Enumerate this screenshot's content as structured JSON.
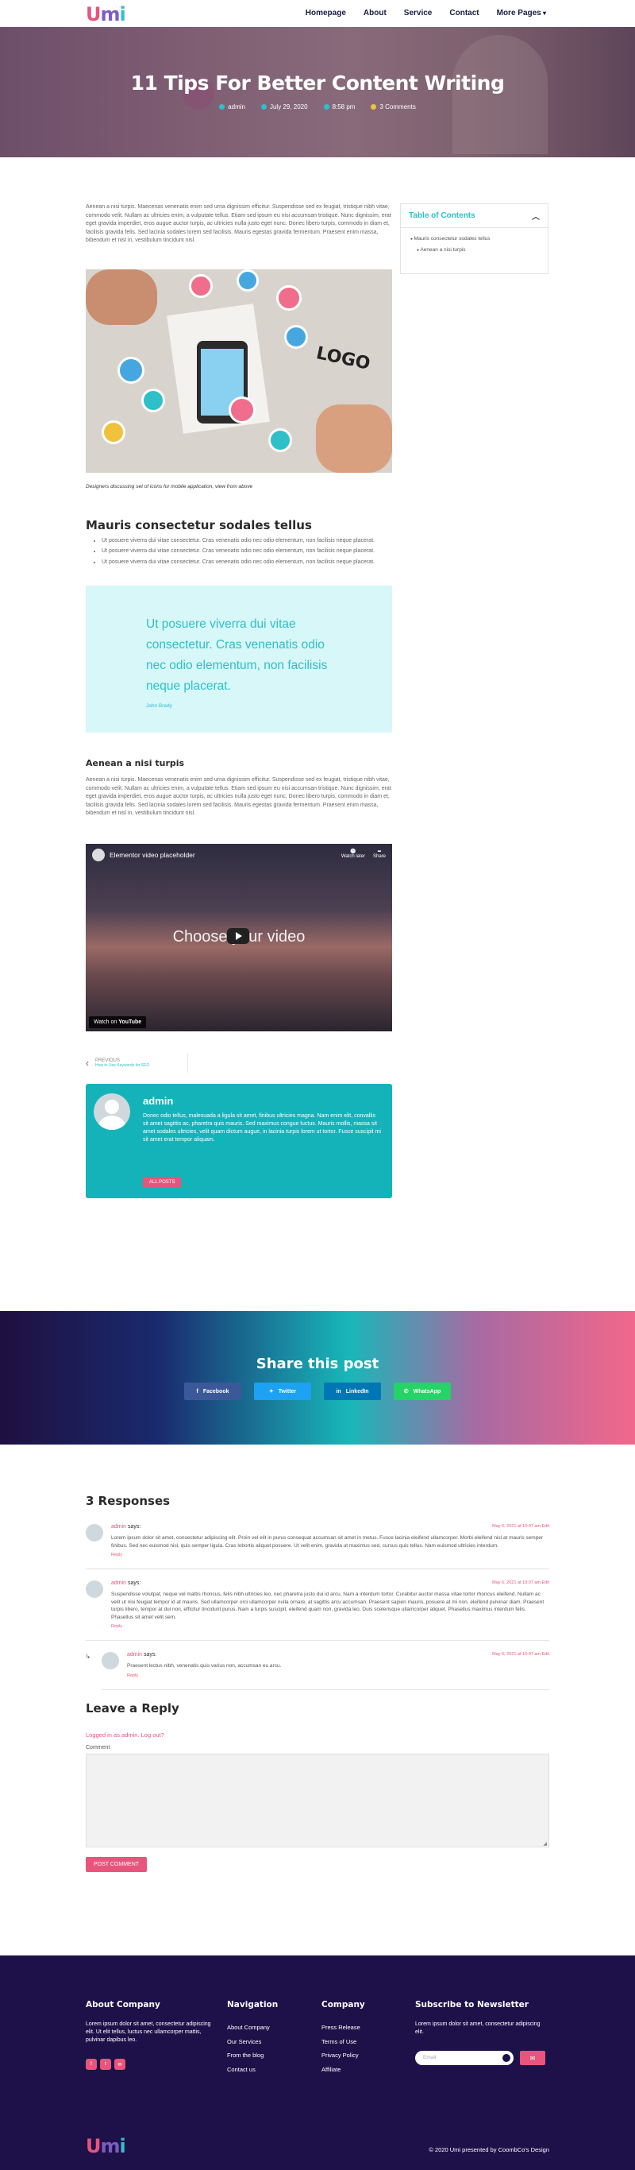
{
  "header": {
    "logo": {
      "u": "U",
      "m": "m",
      "i": "i"
    },
    "nav": [
      "Homepage",
      "About",
      "Service",
      "Contact",
      "More Pages"
    ]
  },
  "hero": {
    "title": "11 Tips For Better Content Writing",
    "meta": {
      "author": "admin",
      "date": "July 29, 2020",
      "time": "8:58 pm",
      "comments": "3 Comments"
    }
  },
  "article": {
    "intro": "Aenean a nisi turpis. Maecenas venenatis enim sed urna dignissim efficitur. Suspendisse sed ex feugiat, tristique nibh vitae, commodo velit. Nullam ac ultricies enim, a vulputate tellus. Etiam sed ipsum eu nisi accumsan tristique. Nunc dignissim, erat eget gravida imperdiet, eros augue auctor turpis, ac ultricies nulla justo eget nunc. Donec libero turpis, commodo in diam et, facilisis gravida felis. Sed lacinia sodales lorem sed facilisis. Mauris egestas gravida fermentum. Praesent enim massa, bibendum et nisl in, vestibulum tincidunt nisl.",
    "image_logo_text": "LOGO",
    "caption": "Designers discussing set of icons for mobile application, view from above",
    "h2": "Mauris consectetur sodales tellus",
    "bullets": [
      "Ut posuere viverra dui vitae consectetur. Cras venenatis odio nec odio elementum, non facilisis neque placerat.",
      "Ut posuere viverra dui vitae consectetur. Cras venenatis odio nec odio elementum, non facilisis neque placerat.",
      "Ut posuere viverra dui vitae consectetur. Cras venenatis odio nec odio elementum, non facilisis neque placerat."
    ],
    "quote": "Ut posuere viverra dui vitae consectetur. Cras venenatis odio nec odio elementum, non facilisis neque placerat.",
    "quote_author": "John Brady",
    "h3": "Aenean a nisi turpis",
    "para2": "Aenean a nisi turpis. Maecenas venenatis enim sed urna dignissim efficitur. Suspendisse sed ex feugiat, tristique nibh vitae, commodo velit. Nullam ac ultricies enim, a vulputate tellus. Etiam sed ipsum eu nisi accumsan tristique. Nunc dignissim, erat eget gravida imperdiet, eros augue auctor turpis, ac ultricies nulla justo eget nunc. Donec libero turpis, commodo in diam et, facilisis gravida felis. Sed lacinia sodales lorem sed facilisis. Mauris egestas gravida fermentum. Praesent enim massa, bibendum et nisl in, vestibulum tincidunt nisl.",
    "video": {
      "title": "Elementor video placeholder",
      "overlay": "Choose your video",
      "watch_later": "Watch later",
      "share": "Share",
      "watch_on": "Watch on",
      "youtube": "YouTube"
    },
    "prev": {
      "label": "PREVIOUS",
      "title": "How to Use Keywords for SEO"
    },
    "author": {
      "name": "admin",
      "bio": "Donec odio tellus, malesuada a ligula sit amet, finibus ultricies magna. Nam enim elit, convallis sit amet sagittis ac, pharetra quis mauris. Sed maximus congue luctus. Mauris mollis, massa sit amet sodales ultricies, velit quam dictum augue, in lacinia turpis lorem ut tortor. Fusce suscipit mi sit amet erat tempor aliquam.",
      "button": "ALL POSTS"
    }
  },
  "sidebar": {
    "toc_title": "Table of Contents",
    "items": [
      "Mauris consectetur sodales tellus",
      "Aenean a nisi turpis"
    ]
  },
  "share": {
    "title": "Share this post",
    "buttons": [
      "Facebook",
      "Twitter",
      "LinkedIn",
      "WhatsApp"
    ]
  },
  "comments": {
    "title": "3 Responses",
    "list": [
      {
        "author": "admin",
        "says": "says:",
        "date": "May 6, 2021 at 10:07 am Edit",
        "text": "Lorem ipsum dolor sit amet, consectetur adipiscing elit. Proin vel elit in purus consequat accumsan sit amet in metus. Fusce lacinia eleifend ullamcorper. Morbi eleifend nisl at mauris semper finibus. Sed nec euismod nisl, quis semper ligula. Cras lobortis aliquet posuere. Ut velit enim, gravida ut maximus sed, cursus quis tellus. Nam euismod ultricies interdum.",
        "reply": "Reply"
      },
      {
        "author": "admin",
        "says": "says:",
        "date": "May 6, 2021 at 10:07 am Edit",
        "text": "Suspendisse volutpat, neque vel mattis rhoncus, felis nibh ultricies leo, nec pharetra justo dui id arcu. Nam a interdum tortor. Curabitur auctor massa vitae tortor rhoncus eleifend. Nullam ac velit ut nisi feugiat tempor id at mauris. Sed ullamcorper orci ullamcorper nulla ornare, at sagittis arcu accumsan. Praesent sapien mauris, posuere at mi non, eleifend pulvinar diam. Praesent turpis libero, tempor at dui non, efficitur tincidunt purus. Nam a turpis suscipit, eleifend quam non, gravida leo. Duis scelerisque ullamcorper aliquet. Phasellus maximus interdum felis. Phasellus sit amet velit sem.",
        "reply": "Reply"
      },
      {
        "author": "admin",
        "says": "says:",
        "date": "May 6, 2021 at 10:07 am Edit",
        "text": "Praesent lectus nibh, venenatis quis varius non, accumsan eu arcu.",
        "reply": "Reply"
      }
    ],
    "leave_title": "Leave a Reply",
    "logged": "Logged in as admin. Log out?",
    "comment_label": "Comment",
    "post_button": "POST COMMENT"
  },
  "footer": {
    "about_title": "About Company",
    "about_text": "Lorem ipsum dolor sit amet, consectetur adipiscing elit. Ut elit tellus, luctus nec ullamcorper mattis, pulvinar dapibus leo.",
    "nav_title": "Navigation",
    "nav": [
      "About Company",
      "Our Services",
      "From the blog",
      "Contact us"
    ],
    "company_title": "Company",
    "company": [
      "Press Release",
      "Terms of Use",
      "Privacy Policy",
      "Affiliate"
    ],
    "newsletter_title": "Subscribe to Newsletter",
    "newsletter_text": "Lorem ipsum dolor sit amet, consectetur adipiscing elit.",
    "email_placeholder": "Email",
    "copyright": "© 2020 Umi presented by CoombCo's Design"
  },
  "colors": {
    "pink": "#e8547c",
    "teal": "#2fbfc8",
    "navy": "#1e1149"
  }
}
